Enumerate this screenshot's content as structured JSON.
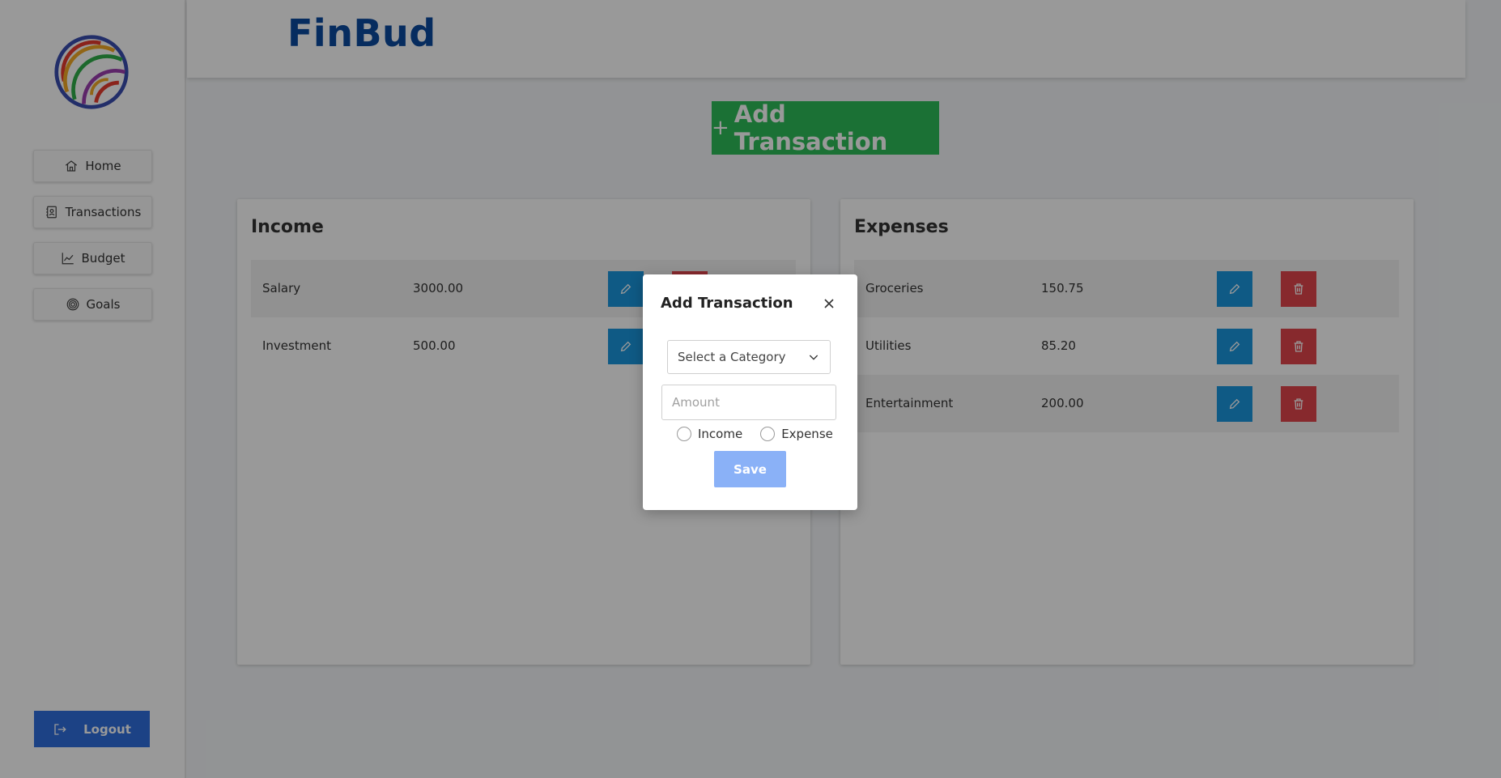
{
  "brand": {
    "name": "FinBud"
  },
  "sidebar": {
    "items": [
      {
        "label": "Home",
        "icon": "home-icon"
      },
      {
        "label": "Transactions",
        "icon": "contacts-icon"
      },
      {
        "label": "Budget",
        "icon": "chart-line-icon"
      },
      {
        "label": "Goals",
        "icon": "target-icon"
      }
    ],
    "logout_label": "Logout"
  },
  "main": {
    "add_button_label": "Add Transaction",
    "add_button_plus": "+",
    "income": {
      "title": "Income",
      "rows": [
        {
          "name": "Salary",
          "amount": "3000.00"
        },
        {
          "name": "Investment",
          "amount": "500.00"
        }
      ]
    },
    "expenses": {
      "title": "Expenses",
      "rows": [
        {
          "name": "Groceries",
          "amount": "150.75"
        },
        {
          "name": "Utilities",
          "amount": "85.20"
        },
        {
          "name": "Entertainment",
          "amount": "200.00"
        }
      ]
    }
  },
  "modal": {
    "title": "Add Transaction",
    "category_placeholder": "Select a Category",
    "amount_placeholder": "Amount",
    "radio_income": "Income",
    "radio_expense": "Expense",
    "save_label": "Save"
  },
  "colors": {
    "brand": "#0b4a9e",
    "add_button": "#2ebd59",
    "edit_button": "#1a97de",
    "delete_button": "#e2454c",
    "logout_button": "#2f6fde",
    "save_button": "#8ab1f7"
  }
}
